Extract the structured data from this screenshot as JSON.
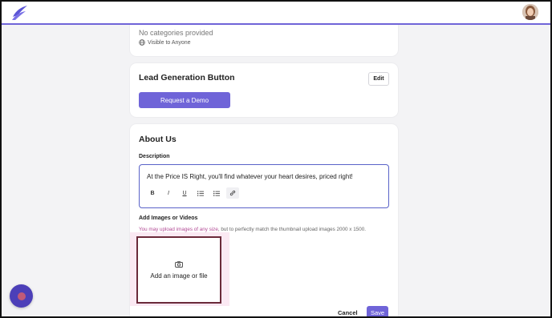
{
  "categories": {
    "empty_text": "No categories provided",
    "visibility": "Visible to Anyone"
  },
  "lead_generation": {
    "title": "Lead Generation Button",
    "edit_label": "Edit",
    "button_label": "Request a Demo"
  },
  "about_us": {
    "title": "About Us",
    "description_label": "Description",
    "description_text": "At the Price IS Right, you'll find whatever your heart desires, priced right!",
    "toolbar": [
      "B",
      "I",
      "U",
      "ordered-list",
      "bullet-list",
      "link"
    ],
    "images_label": "Add Images or Videos",
    "help_link_text": "You may upload images of any size",
    "help_rest_text": ", but to perfectly match the thumbnail upload images 2000 x 1500.",
    "upload_label": "Add an image or file"
  },
  "actions": {
    "cancel_label": "Cancel",
    "save_label": "Save"
  },
  "colors": {
    "accent": "#6f64d8",
    "upload_highlight": "#fbe9f3",
    "upload_border": "#6b2a3a"
  }
}
